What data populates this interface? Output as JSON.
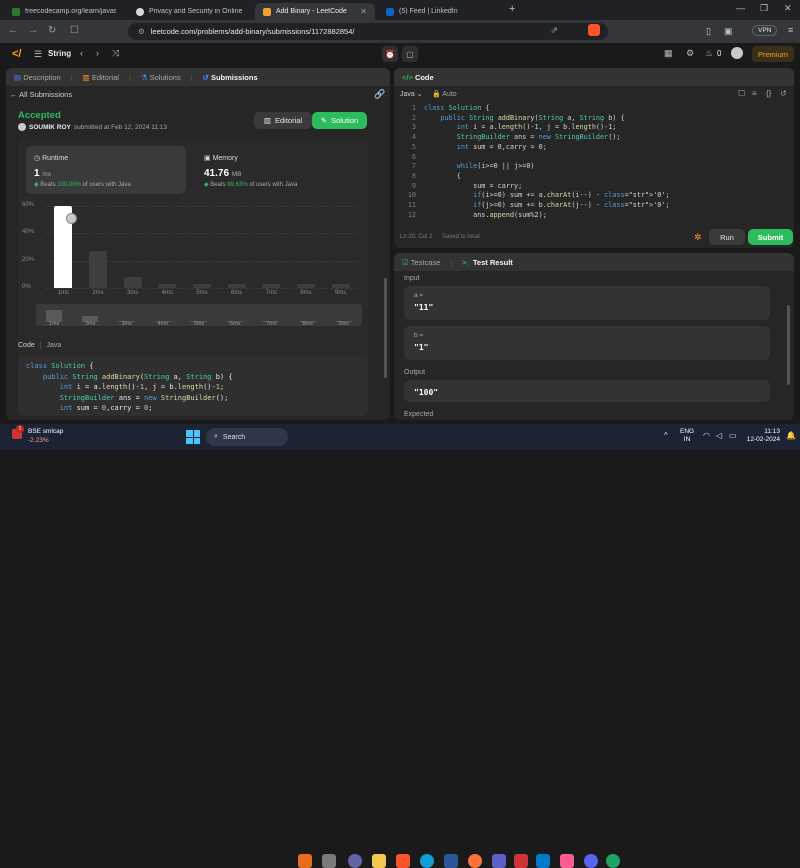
{
  "browser": {
    "tabs": [
      {
        "title": "freecodecamp.org/learn/javascript-a",
        "color": "#2b7a2b"
      },
      {
        "title": "Privacy and Security in Online Social",
        "color": "#e6e6e6"
      },
      {
        "title": "Add Binary - LeetCode",
        "color": "#f0a32c"
      },
      {
        "title": "(5) Feed | LinkedIn",
        "color": "#0a66c2"
      }
    ],
    "url": "leetcode.com/problems/add-binary/submissions/1172882854/",
    "vpn": "VPN"
  },
  "lc_header": {
    "problem_list": "String",
    "premium": "Premium",
    "streak": "0"
  },
  "left": {
    "tabs": [
      "Description",
      "Editorial",
      "Solutions",
      "Submissions"
    ],
    "back": "All Submissions",
    "status": "Accepted",
    "user": "SOUMIK ROY",
    "submitted": "submitted at Feb 12, 2024 11:13",
    "editorial_btn": "Editorial",
    "solution_btn": "Solution",
    "runtime": {
      "label": "Runtime",
      "value": "1",
      "unit": "ms",
      "beats_prefix": "Beats",
      "beats_pct": "100.00%",
      "beats_suffix": "of users with Java"
    },
    "memory": {
      "label": "Memory",
      "value": "41.76",
      "unit": "MB",
      "beats_prefix": "Beats",
      "beats_pct": "89.63%",
      "beats_suffix": "of users with Java"
    },
    "code_tab": "Code",
    "code_lang": "Java",
    "code": [
      [
        "class",
        " ",
        "Solution",
        " {"
      ],
      [
        "    public",
        " String ",
        "addBinary",
        "(String a, String b) {"
      ],
      [
        "        int",
        " i = a.length()-1, j = b.length()-1;"
      ],
      [
        "        StringBuilder",
        " ans = ",
        "new",
        " StringBuilder();"
      ],
      [
        "        int",
        " sum = 0,carry = 0;"
      ]
    ]
  },
  "chart_data": {
    "type": "bar",
    "categories": [
      "1ms",
      "2ms",
      "3ms",
      "4ms",
      "5ms",
      "6ms",
      "7ms",
      "8ms",
      "9ms"
    ],
    "values": [
      60,
      27,
      8,
      3,
      3,
      3,
      3,
      3,
      3
    ],
    "ylim": [
      0,
      60
    ],
    "yticks": [
      "60%",
      "40%",
      "20%",
      "0%"
    ],
    "highlight": "1ms",
    "minimap": [
      10,
      5,
      1,
      0.6,
      0.6,
      0.6,
      0.6,
      0.6,
      0.6
    ],
    "xlabel": "",
    "ylabel": ""
  },
  "editor": {
    "tab": "Code",
    "lang": "Java",
    "mode": "Auto",
    "status_pos": "Ln 20, Col 2",
    "status_saved": "Saved to local",
    "run": "Run",
    "submit": "Submit",
    "lines": [
      {
        "n": "1",
        "t": "class Solution {"
      },
      {
        "n": "2",
        "t": "    public String addBinary(String a, String b) {"
      },
      {
        "n": "3",
        "t": "        int i = a.length()-1, j = b.length()-1;"
      },
      {
        "n": "4",
        "t": "        StringBuilder ans = new StringBuilder();"
      },
      {
        "n": "5",
        "t": "        int sum = 0,carry = 0;"
      },
      {
        "n": "6",
        "t": ""
      },
      {
        "n": "7",
        "t": "        while(i>=0 || j>=0)"
      },
      {
        "n": "8",
        "t": "        {"
      },
      {
        "n": "9",
        "t": "            sum = carry;"
      },
      {
        "n": "10",
        "t": "            if(i>=0) sum += a.charAt(i--) - '0';"
      },
      {
        "n": "11",
        "t": "            if(j>=0) sum += b.charAt(j--) - '0';"
      },
      {
        "n": "12",
        "t": "            ans.append(sum%2);"
      }
    ]
  },
  "tests": {
    "tab1": "Testcase",
    "tab2": "Test Result",
    "input_label": "Input",
    "a_label": "a =",
    "a_value": "\"11\"",
    "b_label": "b =",
    "b_value": "\"1\"",
    "output_label": "Output",
    "output_value": "\"100\"",
    "expected_label": "Expected"
  },
  "taskbar": {
    "stock_name": "BSE smlcap",
    "stock_change": "-2.23%",
    "search": "Search",
    "lang1": "ENG",
    "lang2": "IN",
    "time": "11:13",
    "date": "12-02-2024",
    "badge": "1"
  }
}
